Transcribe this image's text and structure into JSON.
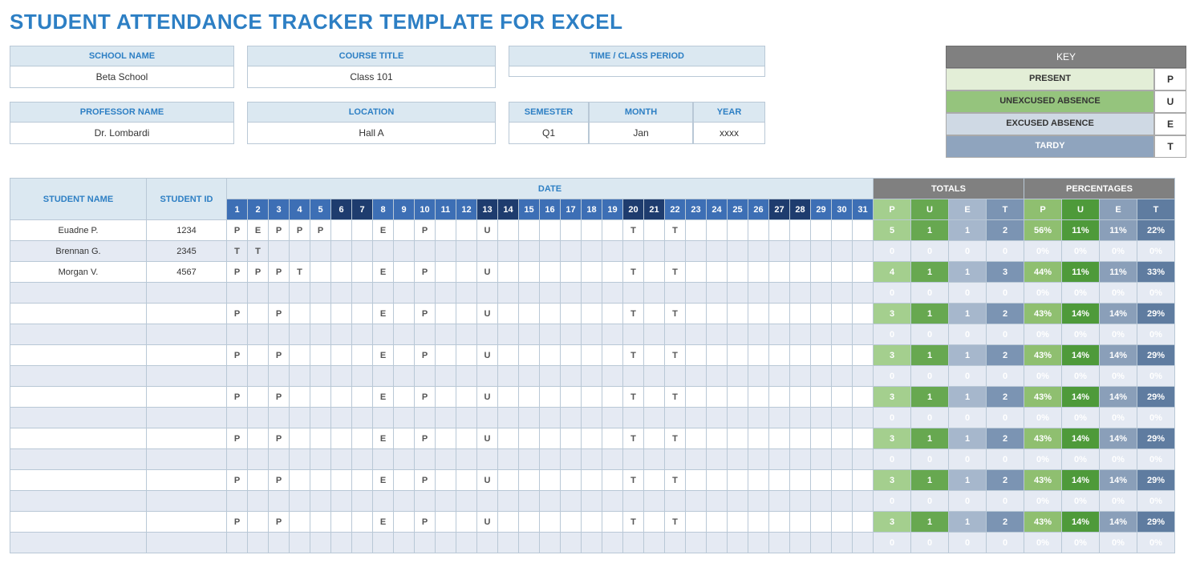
{
  "title": "STUDENT ATTENDANCE TRACKER TEMPLATE FOR EXCEL",
  "fields": {
    "school_name_hdr": "SCHOOL NAME",
    "school_name": "Beta School",
    "course_title_hdr": "COURSE TITLE",
    "course_title": "Class 101",
    "time_period_hdr": "TIME / CLASS PERIOD",
    "time_period": "",
    "professor_hdr": "PROFESSOR NAME",
    "professor": "Dr. Lombardi",
    "location_hdr": "LOCATION",
    "location": "Hall A",
    "semester_hdr": "SEMESTER",
    "semester": "Q1",
    "month_hdr": "MONTH",
    "month": "Jan",
    "year_hdr": "YEAR",
    "year": "xxxx"
  },
  "key": {
    "title": "KEY",
    "present": "PRESENT",
    "present_code": "P",
    "unexcused": "UNEXCUSED ABSENCE",
    "unexcused_code": "U",
    "excused": "EXCUSED ABSENCE",
    "excused_code": "E",
    "tardy": "TARDY",
    "tardy_code": "T"
  },
  "headers": {
    "student_name": "STUDENT NAME",
    "student_id": "STUDENT ID",
    "date": "DATE",
    "totals": "TOTALS",
    "percentages": "PERCENTAGES",
    "P": "P",
    "U": "U",
    "E": "E",
    "T": "T"
  },
  "days": [
    "1",
    "2",
    "3",
    "4",
    "5",
    "6",
    "7",
    "8",
    "9",
    "10",
    "11",
    "12",
    "13",
    "14",
    "15",
    "16",
    "17",
    "18",
    "19",
    "20",
    "21",
    "22",
    "23",
    "24",
    "25",
    "26",
    "27",
    "28",
    "29",
    "30",
    "31"
  ],
  "dark_days": [
    6,
    7,
    13,
    14,
    20,
    21,
    27,
    28
  ],
  "students": [
    {
      "name": "Euadne P.",
      "id": "1234",
      "marks": [
        "P",
        "E",
        "P",
        "P",
        "P",
        "",
        "",
        "E",
        "",
        "P",
        "",
        "",
        "U",
        "",
        "",
        "",
        "",
        "",
        "",
        "T",
        "",
        "T",
        "",
        "",
        "",
        "",
        "",
        "",
        "",
        "",
        ""
      ],
      "totals": [
        "5",
        "1",
        "1",
        "2"
      ],
      "pct": [
        "56%",
        "11%",
        "11%",
        "22%"
      ]
    },
    {
      "name": "Brennan G.",
      "id": "2345",
      "marks": [
        "T",
        "T",
        "",
        "",
        "",
        "",
        "",
        "",
        "",
        "",
        "",
        "",
        "",
        "",
        "",
        "",
        "",
        "",
        "",
        "",
        "",
        "",
        "",
        "",
        "",
        "",
        "",
        "",
        "",
        "",
        ""
      ],
      "totals": [
        "0",
        "0",
        "0",
        "0"
      ],
      "pct": [
        "0%",
        "0%",
        "0%",
        "0%"
      ]
    },
    {
      "name": "Morgan V.",
      "id": "4567",
      "marks": [
        "P",
        "P",
        "P",
        "T",
        "",
        "",
        "",
        "E",
        "",
        "P",
        "",
        "",
        "U",
        "",
        "",
        "",
        "",
        "",
        "",
        "T",
        "",
        "T",
        "",
        "",
        "",
        "",
        "",
        "",
        "",
        "",
        ""
      ],
      "totals": [
        "4",
        "1",
        "1",
        "3"
      ],
      "pct": [
        "44%",
        "11%",
        "11%",
        "33%"
      ]
    },
    {
      "name": "",
      "id": "",
      "marks": [
        "",
        "",
        "",
        "",
        "",
        "",
        "",
        "",
        "",
        "",
        "",
        "",
        "",
        "",
        "",
        "",
        "",
        "",
        "",
        "",
        "",
        "",
        "",
        "",
        "",
        "",
        "",
        "",
        "",
        "",
        ""
      ],
      "totals": [
        "0",
        "0",
        "0",
        "0"
      ],
      "pct": [
        "0%",
        "0%",
        "0%",
        "0%"
      ]
    },
    {
      "name": "",
      "id": "",
      "marks": [
        "P",
        "",
        "P",
        "",
        "",
        "",
        "",
        "E",
        "",
        "P",
        "",
        "",
        "U",
        "",
        "",
        "",
        "",
        "",
        "",
        "T",
        "",
        "T",
        "",
        "",
        "",
        "",
        "",
        "",
        "",
        "",
        ""
      ],
      "totals": [
        "3",
        "1",
        "1",
        "2"
      ],
      "pct": [
        "43%",
        "14%",
        "14%",
        "29%"
      ]
    },
    {
      "name": "",
      "id": "",
      "marks": [
        "",
        "",
        "",
        "",
        "",
        "",
        "",
        "",
        "",
        "",
        "",
        "",
        "",
        "",
        "",
        "",
        "",
        "",
        "",
        "",
        "",
        "",
        "",
        "",
        "",
        "",
        "",
        "",
        "",
        "",
        ""
      ],
      "totals": [
        "0",
        "0",
        "0",
        "0"
      ],
      "pct": [
        "0%",
        "0%",
        "0%",
        "0%"
      ]
    },
    {
      "name": "",
      "id": "",
      "marks": [
        "P",
        "",
        "P",
        "",
        "",
        "",
        "",
        "E",
        "",
        "P",
        "",
        "",
        "U",
        "",
        "",
        "",
        "",
        "",
        "",
        "T",
        "",
        "T",
        "",
        "",
        "",
        "",
        "",
        "",
        "",
        "",
        ""
      ],
      "totals": [
        "3",
        "1",
        "1",
        "2"
      ],
      "pct": [
        "43%",
        "14%",
        "14%",
        "29%"
      ]
    },
    {
      "name": "",
      "id": "",
      "marks": [
        "",
        "",
        "",
        "",
        "",
        "",
        "",
        "",
        "",
        "",
        "",
        "",
        "",
        "",
        "",
        "",
        "",
        "",
        "",
        "",
        "",
        "",
        "",
        "",
        "",
        "",
        "",
        "",
        "",
        "",
        ""
      ],
      "totals": [
        "0",
        "0",
        "0",
        "0"
      ],
      "pct": [
        "0%",
        "0%",
        "0%",
        "0%"
      ]
    },
    {
      "name": "",
      "id": "",
      "marks": [
        "P",
        "",
        "P",
        "",
        "",
        "",
        "",
        "E",
        "",
        "P",
        "",
        "",
        "U",
        "",
        "",
        "",
        "",
        "",
        "",
        "T",
        "",
        "T",
        "",
        "",
        "",
        "",
        "",
        "",
        "",
        "",
        ""
      ],
      "totals": [
        "3",
        "1",
        "1",
        "2"
      ],
      "pct": [
        "43%",
        "14%",
        "14%",
        "29%"
      ]
    },
    {
      "name": "",
      "id": "",
      "marks": [
        "",
        "",
        "",
        "",
        "",
        "",
        "",
        "",
        "",
        "",
        "",
        "",
        "",
        "",
        "",
        "",
        "",
        "",
        "",
        "",
        "",
        "",
        "",
        "",
        "",
        "",
        "",
        "",
        "",
        "",
        ""
      ],
      "totals": [
        "0",
        "0",
        "0",
        "0"
      ],
      "pct": [
        "0%",
        "0%",
        "0%",
        "0%"
      ]
    },
    {
      "name": "",
      "id": "",
      "marks": [
        "P",
        "",
        "P",
        "",
        "",
        "",
        "",
        "E",
        "",
        "P",
        "",
        "",
        "U",
        "",
        "",
        "",
        "",
        "",
        "",
        "T",
        "",
        "T",
        "",
        "",
        "",
        "",
        "",
        "",
        "",
        "",
        ""
      ],
      "totals": [
        "3",
        "1",
        "1",
        "2"
      ],
      "pct": [
        "43%",
        "14%",
        "14%",
        "29%"
      ]
    },
    {
      "name": "",
      "id": "",
      "marks": [
        "",
        "",
        "",
        "",
        "",
        "",
        "",
        "",
        "",
        "",
        "",
        "",
        "",
        "",
        "",
        "",
        "",
        "",
        "",
        "",
        "",
        "",
        "",
        "",
        "",
        "",
        "",
        "",
        "",
        "",
        ""
      ],
      "totals": [
        "0",
        "0",
        "0",
        "0"
      ],
      "pct": [
        "0%",
        "0%",
        "0%",
        "0%"
      ]
    },
    {
      "name": "",
      "id": "",
      "marks": [
        "P",
        "",
        "P",
        "",
        "",
        "",
        "",
        "E",
        "",
        "P",
        "",
        "",
        "U",
        "",
        "",
        "",
        "",
        "",
        "",
        "T",
        "",
        "T",
        "",
        "",
        "",
        "",
        "",
        "",
        "",
        "",
        ""
      ],
      "totals": [
        "3",
        "1",
        "1",
        "2"
      ],
      "pct": [
        "43%",
        "14%",
        "14%",
        "29%"
      ]
    },
    {
      "name": "",
      "id": "",
      "marks": [
        "",
        "",
        "",
        "",
        "",
        "",
        "",
        "",
        "",
        "",
        "",
        "",
        "",
        "",
        "",
        "",
        "",
        "",
        "",
        "",
        "",
        "",
        "",
        "",
        "",
        "",
        "",
        "",
        "",
        "",
        ""
      ],
      "totals": [
        "0",
        "0",
        "0",
        "0"
      ],
      "pct": [
        "0%",
        "0%",
        "0%",
        "0%"
      ]
    },
    {
      "name": "",
      "id": "",
      "marks": [
        "P",
        "",
        "P",
        "",
        "",
        "",
        "",
        "E",
        "",
        "P",
        "",
        "",
        "U",
        "",
        "",
        "",
        "",
        "",
        "",
        "T",
        "",
        "T",
        "",
        "",
        "",
        "",
        "",
        "",
        "",
        "",
        ""
      ],
      "totals": [
        "3",
        "1",
        "1",
        "2"
      ],
      "pct": [
        "43%",
        "14%",
        "14%",
        "29%"
      ]
    },
    {
      "name": "",
      "id": "",
      "marks": [
        "",
        "",
        "",
        "",
        "",
        "",
        "",
        "",
        "",
        "",
        "",
        "",
        "",
        "",
        "",
        "",
        "",
        "",
        "",
        "",
        "",
        "",
        "",
        "",
        "",
        "",
        "",
        "",
        "",
        "",
        ""
      ],
      "totals": [
        "0",
        "0",
        "0",
        "0"
      ],
      "pct": [
        "0%",
        "0%",
        "0%",
        "0%"
      ]
    }
  ]
}
